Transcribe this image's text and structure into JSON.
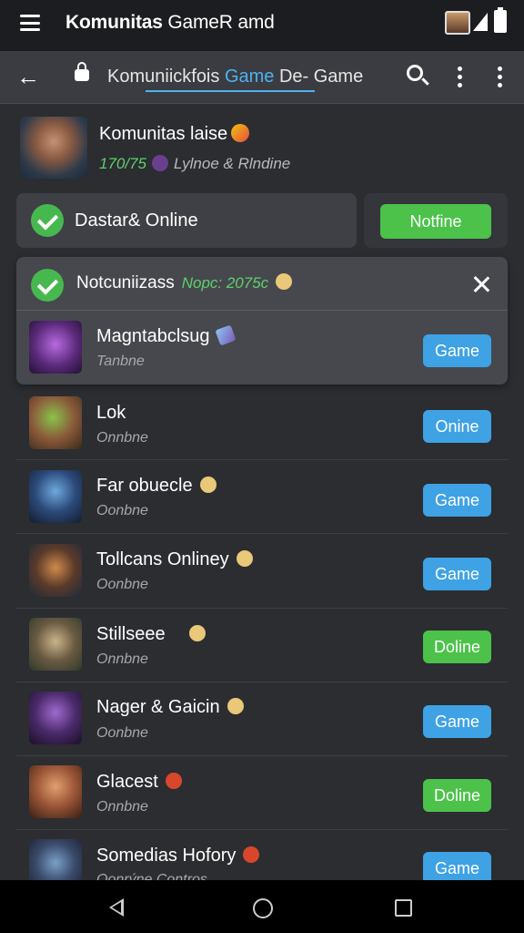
{
  "app_bar": {
    "title_bold": "Komunitas",
    "title_rest": " GameR amd"
  },
  "url_bar": {
    "url_pre": "Komuniickfois ",
    "url_highlight": "Game",
    "url_post": " De- Game"
  },
  "community": {
    "title": "Komunitas laise",
    "member_count": "170/75",
    "meta_text": "Lylnoe & Rlndine"
  },
  "status_card": {
    "label": "Dastar& Online",
    "button_label": "Notfine"
  },
  "notification": {
    "title": "Notcuniizass",
    "subtitle": "Nopc: 2075c",
    "featured": {
      "name": "Magntabclsug",
      "status": "Tanbne",
      "button": "Game"
    }
  },
  "players": [
    {
      "name": "Lok",
      "status": "Onnbne",
      "button": "Onine",
      "button_color": "blue",
      "emoji": ""
    },
    {
      "name": "Far obuecle",
      "status": "Oonbne",
      "button": "Game",
      "button_color": "blue",
      "emoji": "smile"
    },
    {
      "name": "Tollcans Onliney",
      "status": "Oonbne",
      "button": "Game",
      "button_color": "blue",
      "emoji": "smile"
    },
    {
      "name": "Stillseee",
      "status": "Onnbne",
      "button": "Doline",
      "button_color": "green",
      "emoji": "smile"
    },
    {
      "name": "Nager & Gaicin",
      "status": "Oonbne",
      "button": "Game",
      "button_color": "blue",
      "emoji": "smile"
    },
    {
      "name": "Glacest",
      "status": "Onnbne",
      "button": "Doline",
      "button_color": "green",
      "emoji": "red"
    },
    {
      "name": "Somedias Hofory",
      "status": "Oonrýne Contros",
      "button": "Game",
      "button_color": "blue",
      "emoji": "red"
    }
  ],
  "icons": [
    "menu-icon",
    "back-arrow-icon",
    "lock-icon",
    "search-icon",
    "more-vert-icon",
    "check-icon",
    "close-icon",
    "nav-back-icon",
    "nav-home-icon",
    "nav-recents-icon"
  ],
  "colors": {
    "accent_green": "#4cc24a",
    "accent_blue": "#3ea2e4",
    "background": "#2b2d31"
  }
}
